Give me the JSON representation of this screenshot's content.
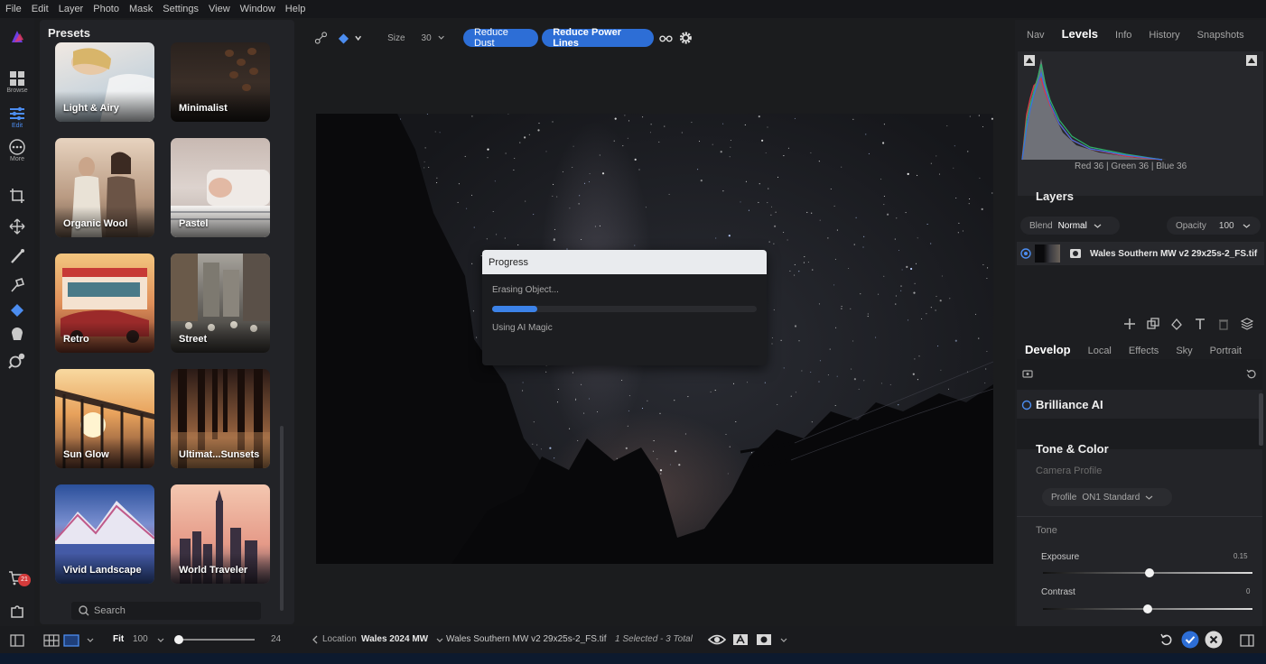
{
  "menu": [
    "File",
    "Edit",
    "Layer",
    "Photo",
    "Mask",
    "Settings",
    "View",
    "Window",
    "Help"
  ],
  "rail": {
    "browse_label": "Browse",
    "edit_label": "Edit",
    "more_label": "More",
    "cart_count": "21"
  },
  "presets": {
    "title": "Presets",
    "items": [
      {
        "label": "Light & Airy"
      },
      {
        "label": "Minimalist"
      },
      {
        "label": "Organic Wool"
      },
      {
        "label": "Pastel"
      },
      {
        "label": "Retro"
      },
      {
        "label": "Street"
      },
      {
        "label": "Sun Glow"
      },
      {
        "label": "Ultimat...Sunsets"
      },
      {
        "label": "Vivid Landscape"
      },
      {
        "label": "World Traveler"
      }
    ],
    "search_placeholder": "Search"
  },
  "toolbar": {
    "size_label": "Size",
    "size_value": "30",
    "reduce_dust": "Reduce Dust",
    "reduce_power_lines": "Reduce Power Lines"
  },
  "dialog": {
    "title": "Progress",
    "status": "Erasing Object...",
    "progress": 0.17,
    "substatus": "Using AI Magic"
  },
  "right": {
    "top_tabs": [
      {
        "label": "Nav",
        "selected": false
      },
      {
        "label": "Levels",
        "selected": true
      },
      {
        "label": "Info",
        "selected": false
      },
      {
        "label": "History",
        "selected": false
      },
      {
        "label": "Snapshots",
        "selected": false
      }
    ],
    "rgb_readout": "Red  36  | Green  36  | Blue  36",
    "layers_title": "Layers",
    "blend_label": "Blend",
    "blend_value": "Normal",
    "opacity_label": "Opacity",
    "opacity_value": "100",
    "layer_name": "Wales Southern MW v2 29x25s-2_FS.tif",
    "dev_tabs": [
      {
        "label": "Develop",
        "selected": true
      },
      {
        "label": "Local",
        "selected": false
      },
      {
        "label": "Effects",
        "selected": false
      },
      {
        "label": "Sky",
        "selected": false
      },
      {
        "label": "Portrait",
        "selected": false
      }
    ],
    "brilliance": "Brilliance AI",
    "tone_color": "Tone & Color",
    "camera_profile": "Camera Profile",
    "profile_label": "Profile",
    "profile_value": "ON1 Standard",
    "tone": "Tone",
    "exposure_label": "Exposure",
    "exposure_value": "0.15",
    "exposure_pos": 0.51,
    "contrast_label": "Contrast",
    "contrast_value": "0",
    "contrast_pos": 0.5
  },
  "bottom": {
    "fit_label": "Fit",
    "zoom_value": "100",
    "thumb_size": "24",
    "location_label": "Location",
    "location_value": "Wales 2024 MW",
    "filename": "Wales Southern MW v2 29x25s-2_FS.tif",
    "selection": "1 Selected - 3 Total"
  },
  "colors": {
    "accent": "#2d6ed6",
    "badge": "#d43b3b"
  },
  "icons": [
    "browse-icon",
    "edit-sliders-icon",
    "more-icon",
    "crop-icon",
    "transform-icon",
    "brush-icon",
    "retouch-icon",
    "perfect-eraser-icon",
    "masking-icon",
    "search-zoom-icon",
    "cart-icon",
    "puzzle-icon",
    "glasses-icon",
    "gear-icon",
    "eye-icon",
    "undo-icon",
    "check-icon",
    "close-icon"
  ]
}
